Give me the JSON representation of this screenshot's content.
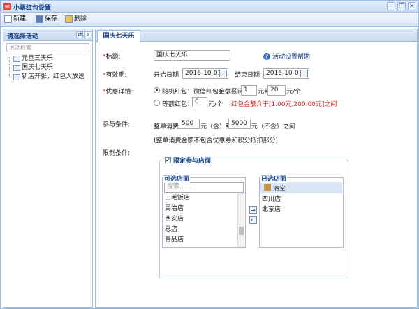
{
  "window": {
    "title": "小票红包设置",
    "app_icon": "red-packet-icon",
    "controls": [
      "minimize",
      "maximize",
      "close"
    ]
  },
  "toolbar": {
    "new_label": "新建",
    "save_label": "保存",
    "delete_label": "删除"
  },
  "sidebar": {
    "title": "请选择活动",
    "search_placeholder": "活动检索",
    "items": [
      {
        "label": "元旦三天乐"
      },
      {
        "label": "国庆七天乐"
      },
      {
        "label": "新店开张，红包大放送"
      }
    ]
  },
  "tab": {
    "label": "国庆七天乐"
  },
  "form": {
    "title_label": "标题:",
    "title_value": "国庆七天乐",
    "help_link": "活动设置帮助",
    "validity_label": "有效期:",
    "start_label": "开始日期",
    "start_value": "2016-10-01",
    "end_label": "结束日期",
    "end_value": "2016-10-07",
    "discount_label": "优惠详情:",
    "random_label": "随机红包：",
    "random_desc": "微信红包金额区间",
    "random_min": "1",
    "random_mid": "元到",
    "random_max": "20",
    "random_unit": "元/个",
    "fixed_label": "等额红包：",
    "fixed_value": "0",
    "fixed_unit": "元/个",
    "fixed_hint": "红包金额介于[1.00元,200.00元]之间",
    "participation_label": "参与条件:",
    "spend_label": "整单消费",
    "spend_min": "500",
    "spend_min_unit": "元（含）到",
    "spend_max": "5000",
    "spend_max_unit": "元（不含）之间",
    "spend_note": "(整单消费金额不包含优惠券和积分抵扣部分)",
    "limit_label": "限制条件:",
    "limit_store_label": "限定参与店面",
    "limit_store_checked": true
  },
  "available_stores": {
    "title": "可选店面",
    "search_placeholder": "搜索......",
    "items": [
      "三毛饭店",
      "民治店",
      "西安店",
      "总店",
      "青品店"
    ]
  },
  "selected_stores": {
    "title": "已选店面",
    "clear_label": "清空",
    "items": [
      "四川店",
      "北京店"
    ]
  },
  "colors": {
    "accent": "#15428b",
    "border": "#99bbe8",
    "required": "#e02020"
  }
}
